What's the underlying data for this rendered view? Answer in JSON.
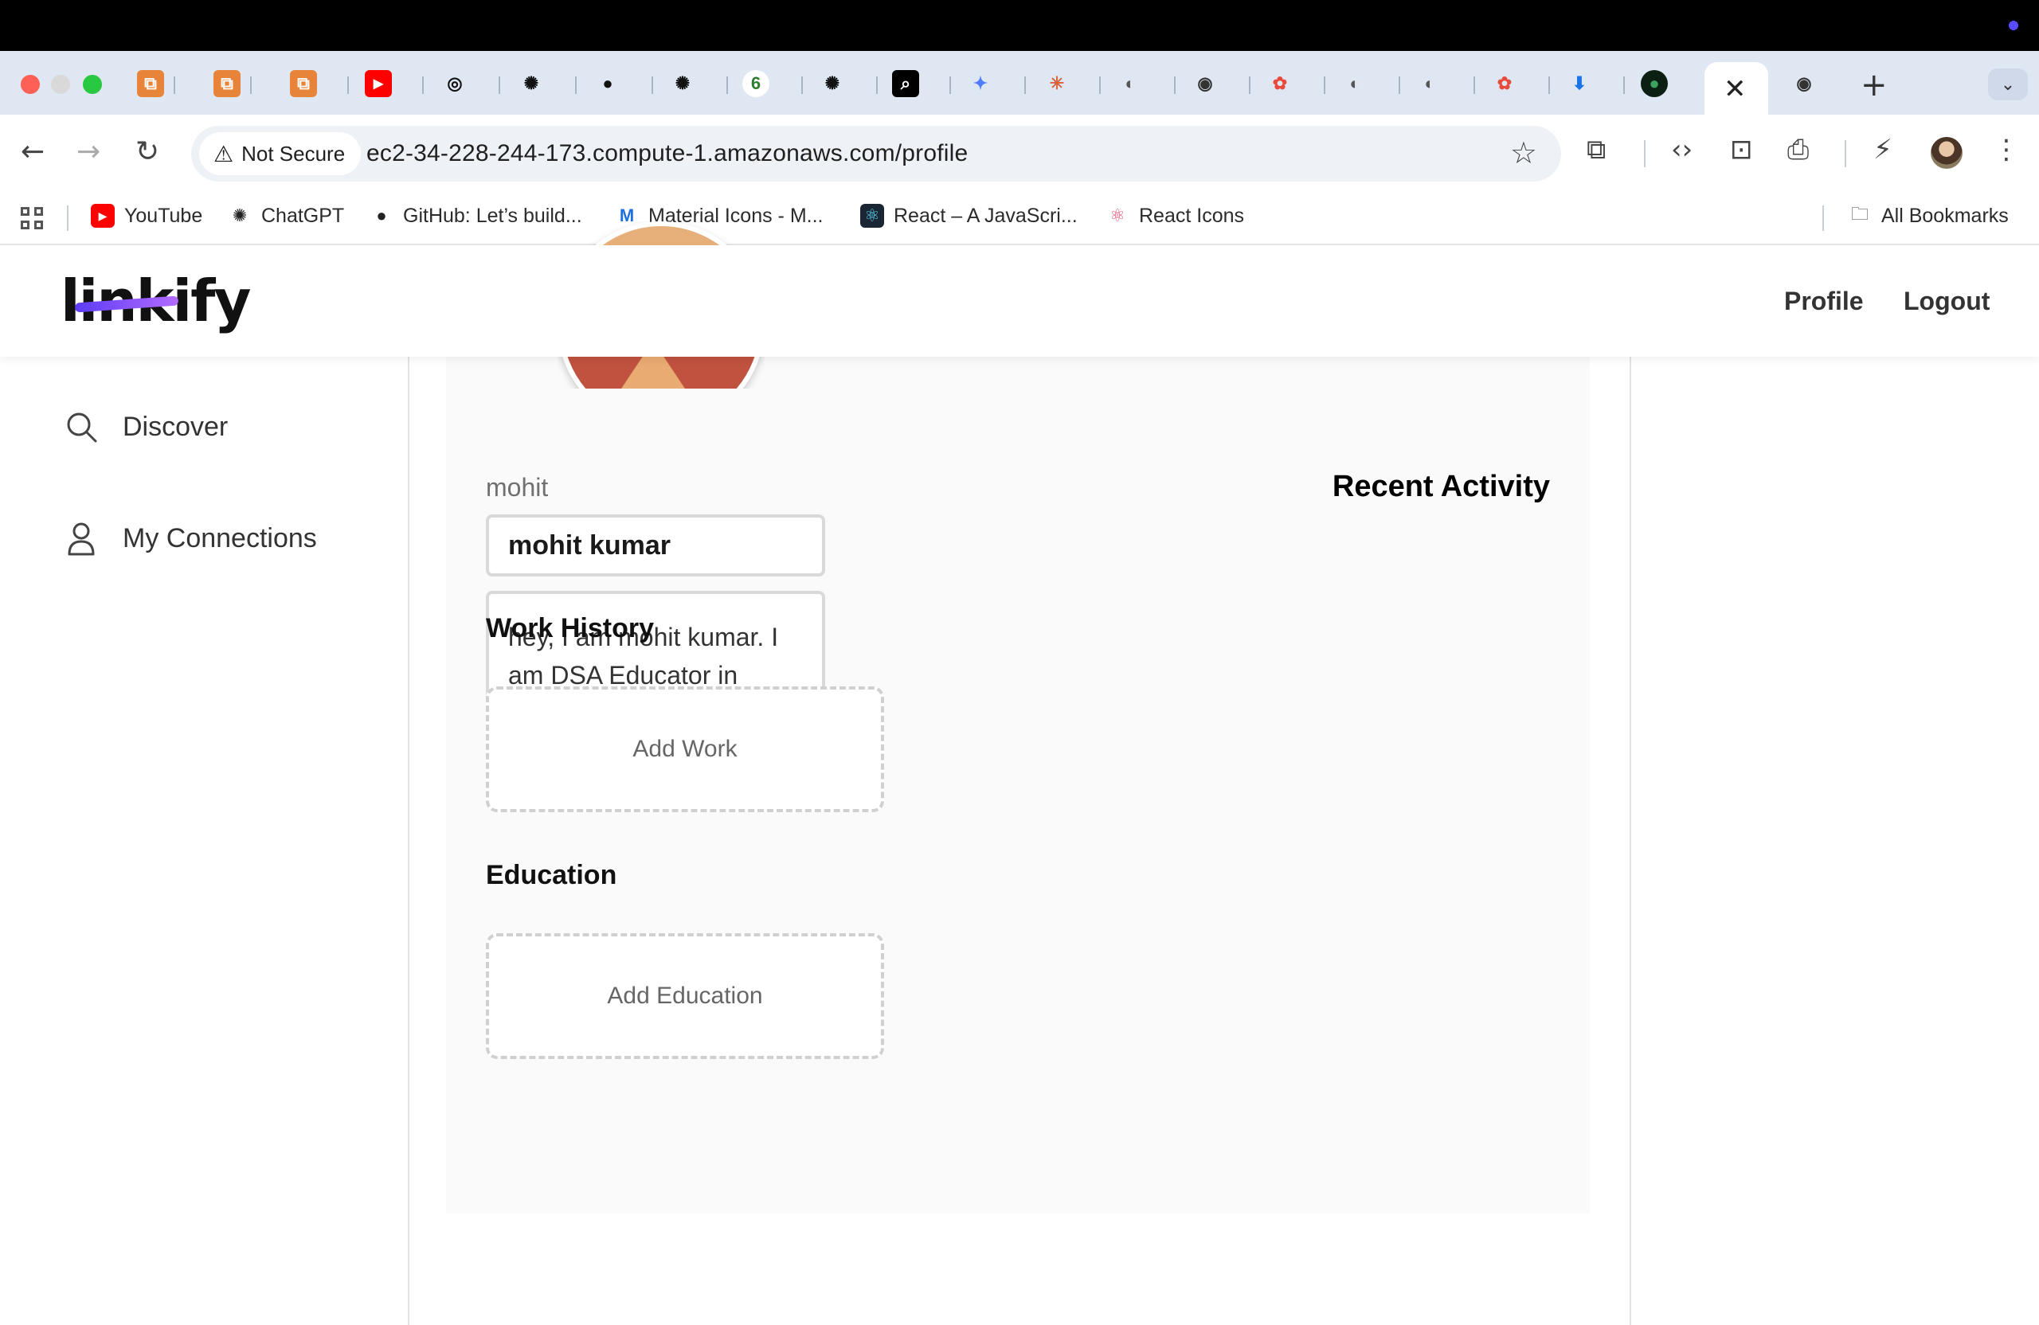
{
  "browser": {
    "address": {
      "security_label": "Not Secure",
      "url": "ec2-34-228-244-173.compute-1.amazonaws.com/profile"
    },
    "bookmarks": [
      {
        "label": "YouTube",
        "icon": "youtube-icon",
        "color": "#ff0000"
      },
      {
        "label": "ChatGPT",
        "icon": "chatgpt-icon",
        "color": "#222222"
      },
      {
        "label": "GitHub: Let’s build...",
        "icon": "github-icon",
        "color": "#222222"
      },
      {
        "label": "Material Icons - M...",
        "icon": "material-icon",
        "color": "#1e6fe0"
      },
      {
        "label": "React – A JavaScri...",
        "icon": "react-icon",
        "color": "#1a2633"
      },
      {
        "label": "React Icons",
        "icon": "react-icons-icon",
        "color": "#e94e77"
      }
    ],
    "all_bookmarks_label": "All Bookmarks"
  },
  "app": {
    "logo_text": "linkify",
    "nav": {
      "profile": "Profile",
      "logout": "Logout"
    },
    "sidebar": {
      "items": [
        {
          "label": "Discover",
          "icon": "search-icon"
        },
        {
          "label": "My Connections",
          "icon": "user-icon"
        }
      ]
    },
    "profile": {
      "username": "mohit",
      "name_value": "mohit kumar",
      "bio_value": "hey, I am mohit kumar. I am DSA Educator in Youtube.",
      "work_history_title": "Work History",
      "add_work_label": "Add Work",
      "education_title": "Education",
      "add_education_label": "Add Education",
      "recent_activity_title": "Recent Activity"
    }
  },
  "colors": {
    "accent": "#5b3cf5",
    "tabstrip": "#dfe7f3"
  }
}
